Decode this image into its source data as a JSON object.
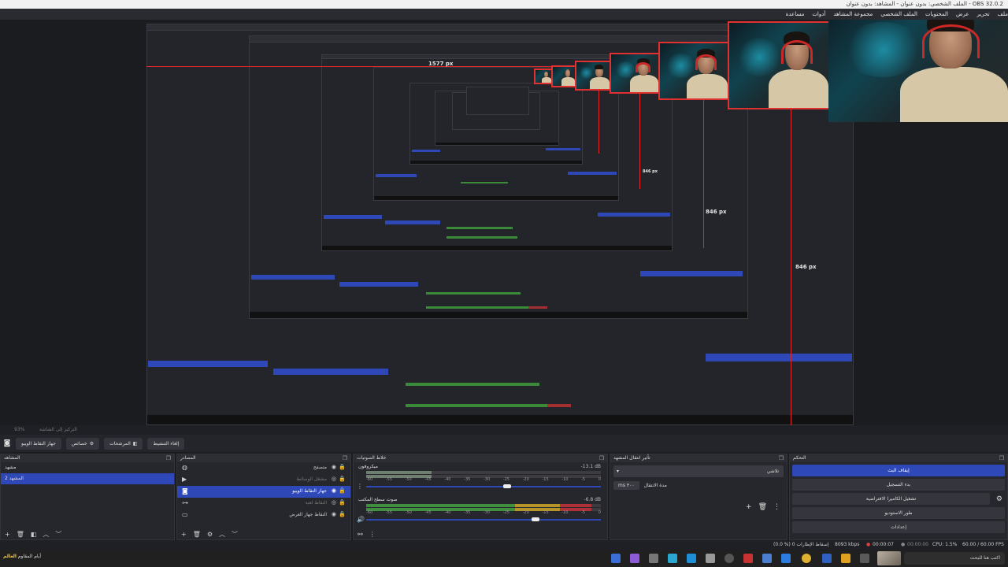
{
  "window": {
    "title": "الملف الشخصي: بدون عنوان - المشاهد: بدون عنوان - OBS 32.0.2"
  },
  "menu": [
    "ملف",
    "تحرير",
    "عرض",
    "المحتويات",
    "الملف الشخصي",
    "مجموعة المشاهد",
    "أدوات",
    "مساعدة"
  ],
  "preview": {
    "size_labels": [
      "1577 px",
      "846 px",
      "846 px",
      "846 px"
    ]
  },
  "toolbar": {
    "zoom": "93%",
    "hint": "التركيز إلى الشاشة"
  },
  "scene_bar": {
    "buttons": [
      {
        "label": "جهاز التقاط الويبو",
        "icon": "camera-icon"
      },
      {
        "label": "خصائص",
        "icon": "gear-icon"
      },
      {
        "label": "المرشحات",
        "icon": "filter-icon"
      },
      {
        "label": "إلغاء التنشيط",
        "icon": ""
      }
    ]
  },
  "scenes": {
    "title": "المشاهد",
    "items": [
      "مشهد",
      "المشهد 2"
    ],
    "selected_index": 1
  },
  "sources": {
    "title": "المصادر",
    "items": [
      {
        "name": "متصفح",
        "icon": "globe-icon",
        "dim": false,
        "selected": false
      },
      {
        "name": "مشغل الوسائط",
        "icon": "play-icon",
        "dim": true,
        "selected": false
      },
      {
        "name": "جهاز التقاط الويبو",
        "icon": "camera-icon",
        "dim": false,
        "selected": true
      },
      {
        "name": "التقاط لعبة",
        "icon": "gamepad-icon",
        "dim": true,
        "selected": false
      },
      {
        "name": "التقاط جهاز العرض",
        "icon": "monitor-icon",
        "dim": false,
        "selected": false
      }
    ]
  },
  "mixer": {
    "title": "خلاط الصوتيات",
    "ticks": [
      "-60",
      "-55",
      "-50",
      "-45",
      "-40",
      "-35",
      "-30",
      "-25",
      "-20",
      "-15",
      "-10",
      "-5",
      "0"
    ],
    "tracks": [
      {
        "name": "ميكروفون",
        "db": "-13.1 dB",
        "meter_level": 0.28,
        "volume": 0.6
      },
      {
        "name": "صوت سطح المكتب",
        "db": "-6.8 dB",
        "meter_level": 0.96,
        "volume": 0.72
      }
    ]
  },
  "transitions": {
    "title": "تأثير انتقال المشهد",
    "selected": "تلاشي",
    "duration_label": "مدة الانتقال",
    "duration_value": "٣٠٠ ms"
  },
  "controls": {
    "title": "التحكم",
    "buttons": [
      {
        "label": "إيقاف البث",
        "active": true
      },
      {
        "label": "بدء التسجيل",
        "active": false
      },
      {
        "label": "تشغيل الكاميرا الافتراضية",
        "active": false,
        "gear": true
      },
      {
        "label": "طور الاستوديو",
        "active": false
      },
      {
        "label": "إعدادات",
        "active": false
      }
    ]
  },
  "status": {
    "dropped": "(0.0 %) 0 إسقاط الإطارات",
    "bitrate": "8093 kbps",
    "live_time": "00:00:07",
    "rec_time": "00:00:00",
    "cpu": "CPU: 1.5%",
    "fps": "60.00 / 60.00 FPS"
  },
  "taskbar": {
    "search_placeholder": "اكتب هنا للبحث",
    "tray_text": "أيام المقاوم",
    "tray_highlight": "العالم"
  }
}
